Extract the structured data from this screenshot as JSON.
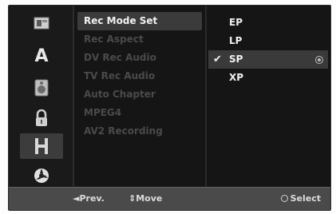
{
  "menu": {
    "items": [
      {
        "label": "Rec Mode Set"
      },
      {
        "label": "Rec Aspect"
      },
      {
        "label": "DV Rec Audio"
      },
      {
        "label": "TV Rec Audio"
      },
      {
        "label": "Auto Chapter"
      },
      {
        "label": "MPEG4"
      },
      {
        "label": "AV2 Recording"
      }
    ],
    "active_index": 0
  },
  "options": {
    "items": [
      {
        "label": "EP"
      },
      {
        "label": "LP"
      },
      {
        "label": "SP"
      },
      {
        "label": "XP"
      }
    ],
    "selected_index": 2,
    "check_glyph": "✔"
  },
  "sidebar": {
    "icons": [
      "disc-icon",
      "language-icon",
      "speaker-icon",
      "lock-icon",
      "recording-icon",
      "others-icon"
    ],
    "active_index": 4,
    "language_icon_glyph": "A"
  },
  "bottombar": {
    "prev_label": "◄Prev.",
    "move_label": "⇕Move",
    "select_label": "Select"
  },
  "colors": {
    "background": "#151515",
    "highlight": "#3b3b3b",
    "text_active": "#f2f2f2",
    "text_inactive": "#4a4a4a",
    "bottombar": "#4a4a4a"
  }
}
